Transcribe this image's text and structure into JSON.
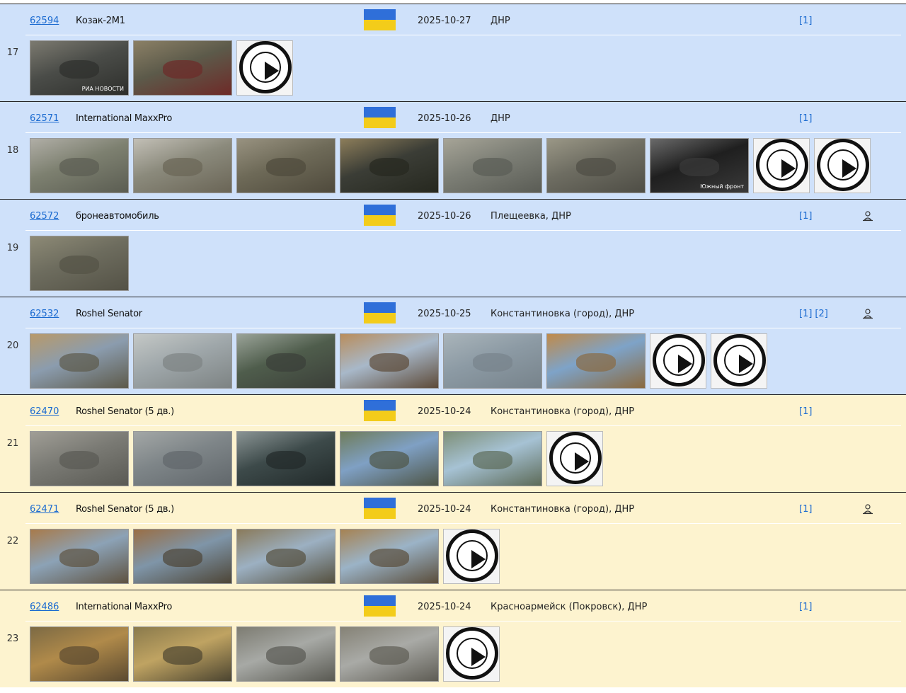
{
  "colors": {
    "row_blue": "#cfe1fa",
    "row_yellow": "#fdf3cf",
    "link": "#1a6ad0",
    "flag_blue": "#2f6fd9",
    "flag_yellow": "#f3cc1a"
  },
  "entries": [
    {
      "num": "17",
      "id": "62594",
      "name": "Козак-2М1",
      "date": "2025-10-27",
      "place": "ДНР",
      "refs": [
        "[1]"
      ],
      "geo": false,
      "bg": "blue",
      "thumbs": [
        {
          "kind": "photo",
          "palette": [
            "#4a4c48",
            "#7c7a70",
            "#2e2f2c"
          ],
          "caption": "РИА НОВОСТИ"
        },
        {
          "kind": "photo",
          "palette": [
            "#5c5a4a",
            "#8b8066",
            "#6e2a28"
          ],
          "caption": ""
        },
        {
          "kind": "video"
        }
      ]
    },
    {
      "num": "18",
      "id": "62571",
      "name": "International MaxxPro",
      "date": "2025-10-26",
      "place": "ДНР",
      "refs": [
        "[1]"
      ],
      "geo": false,
      "bg": "blue",
      "thumbs": [
        {
          "kind": "photo",
          "palette": [
            "#7d8070",
            "#b0aea6",
            "#5b5d52"
          ],
          "caption": ""
        },
        {
          "kind": "photo",
          "palette": [
            "#8b8a7c",
            "#c2bfb6",
            "#6a6556"
          ],
          "caption": ""
        },
        {
          "kind": "photo",
          "palette": [
            "#6e6a58",
            "#989280",
            "#4f4a3c"
          ],
          "caption": ""
        },
        {
          "kind": "photo",
          "palette": [
            "#3b3d36",
            "#8c7d5a",
            "#26281f"
          ],
          "caption": ""
        },
        {
          "kind": "photo",
          "palette": [
            "#7d7f76",
            "#a6a497",
            "#5a5c55"
          ],
          "caption": ""
        },
        {
          "kind": "photo",
          "palette": [
            "#6e6d62",
            "#9a9786",
            "#4e4d45"
          ],
          "caption": ""
        },
        {
          "kind": "photo",
          "palette": [
            "#1f1f1f",
            "#6a6a6a",
            "#3a3a3a"
          ],
          "caption": "Южный фронт"
        },
        {
          "kind": "video"
        },
        {
          "kind": "video"
        }
      ]
    },
    {
      "num": "19",
      "id": "62572",
      "name": "бронеавтомобиль",
      "date": "2025-10-26",
      "place": "Плещеевка, ДНР",
      "refs": [
        "[1]"
      ],
      "geo": true,
      "bg": "blue",
      "thumbs": [
        {
          "kind": "photo",
          "palette": [
            "#6d6c5e",
            "#8d8a76",
            "#545246"
          ],
          "caption": ""
        }
      ]
    },
    {
      "num": "20",
      "id": "62532",
      "name": "Roshel Senator",
      "date": "2025-10-25",
      "place": "Константиновка (город), ДНР",
      "refs": [
        "[1]",
        "[2]"
      ],
      "geo": true,
      "bg": "blue",
      "thumbs": [
        {
          "kind": "photo",
          "palette": [
            "#8b9cae",
            "#b89a6a",
            "#5d5a4a"
          ],
          "caption": ""
        },
        {
          "kind": "photo",
          "palette": [
            "#9fa7aa",
            "#c4c8c6",
            "#7d8383"
          ],
          "caption": ""
        },
        {
          "kind": "photo",
          "palette": [
            "#4f5d4c",
            "#9aa398",
            "#3b3f39"
          ],
          "caption": ""
        },
        {
          "kind": "photo",
          "palette": [
            "#a8b8c9",
            "#b98d5c",
            "#5d4a38"
          ],
          "caption": ""
        },
        {
          "kind": "photo",
          "palette": [
            "#8c9aa4",
            "#a9b4ba",
            "#77838b"
          ],
          "caption": ""
        },
        {
          "kind": "photo",
          "palette": [
            "#7ea3c8",
            "#c08a4a",
            "#8a6a40"
          ],
          "caption": ""
        },
        {
          "kind": "video"
        },
        {
          "kind": "video"
        }
      ]
    },
    {
      "num": "21",
      "id": "62470",
      "name": "Roshel Senator (5 дв.)",
      "date": "2025-10-24",
      "place": "Константиновка (город), ДНР",
      "refs": [
        "[1]"
      ],
      "geo": false,
      "bg": "yellow",
      "thumbs": [
        {
          "kind": "photo",
          "palette": [
            "#7a7a74",
            "#a09e96",
            "#5a5a54"
          ],
          "caption": ""
        },
        {
          "kind": "photo",
          "palette": [
            "#7e8588",
            "#a3a7a6",
            "#61676b"
          ],
          "caption": ""
        },
        {
          "kind": "photo",
          "palette": [
            "#3d4a4a",
            "#8a9494",
            "#222a2a"
          ],
          "caption": ""
        },
        {
          "kind": "photo",
          "palette": [
            "#7fa0c4",
            "#6f7c5a",
            "#4e5546"
          ],
          "caption": ""
        },
        {
          "kind": "photo",
          "palette": [
            "#a6c2d4",
            "#7e8f77",
            "#5d6b58"
          ],
          "caption": ""
        },
        {
          "kind": "video"
        }
      ]
    },
    {
      "num": "22",
      "id": "62471",
      "name": "Roshel Senator (5 дв.)",
      "date": "2025-10-24",
      "place": "Константиновка (город), ДНР",
      "refs": [
        "[1]"
      ],
      "geo": true,
      "bg": "yellow",
      "thumbs": [
        {
          "kind": "photo",
          "palette": [
            "#8ca2b6",
            "#a87a4a",
            "#5e5240"
          ],
          "caption": ""
        },
        {
          "kind": "photo",
          "palette": [
            "#7f95a8",
            "#9a6e44",
            "#4d4536"
          ],
          "caption": ""
        },
        {
          "kind": "photo",
          "palette": [
            "#9cb0c2",
            "#8a7a5a",
            "#55503e"
          ],
          "caption": ""
        },
        {
          "kind": "photo",
          "palette": [
            "#9bb3c7",
            "#a68252",
            "#5a4d3a"
          ],
          "caption": ""
        },
        {
          "kind": "video"
        }
      ]
    },
    {
      "num": "23",
      "id": "62486",
      "name": "International MaxxPro",
      "date": "2025-10-24",
      "place": "Красноармейск (Покровск), ДНР",
      "refs": [
        "[1]"
      ],
      "geo": false,
      "bg": "yellow",
      "thumbs": [
        {
          "kind": "photo",
          "palette": [
            "#b08a4a",
            "#7c6a44",
            "#5b4a30"
          ],
          "caption": ""
        },
        {
          "kind": "photo",
          "palette": [
            "#bfa362",
            "#8a7a4c",
            "#4b4430"
          ],
          "caption": ""
        },
        {
          "kind": "photo",
          "palette": [
            "#a7a9a5",
            "#7d7c72",
            "#595952"
          ],
          "caption": ""
        },
        {
          "kind": "photo",
          "palette": [
            "#a9aaa6",
            "#858276",
            "#5e5c54"
          ],
          "caption": ""
        },
        {
          "kind": "video"
        }
      ]
    }
  ]
}
